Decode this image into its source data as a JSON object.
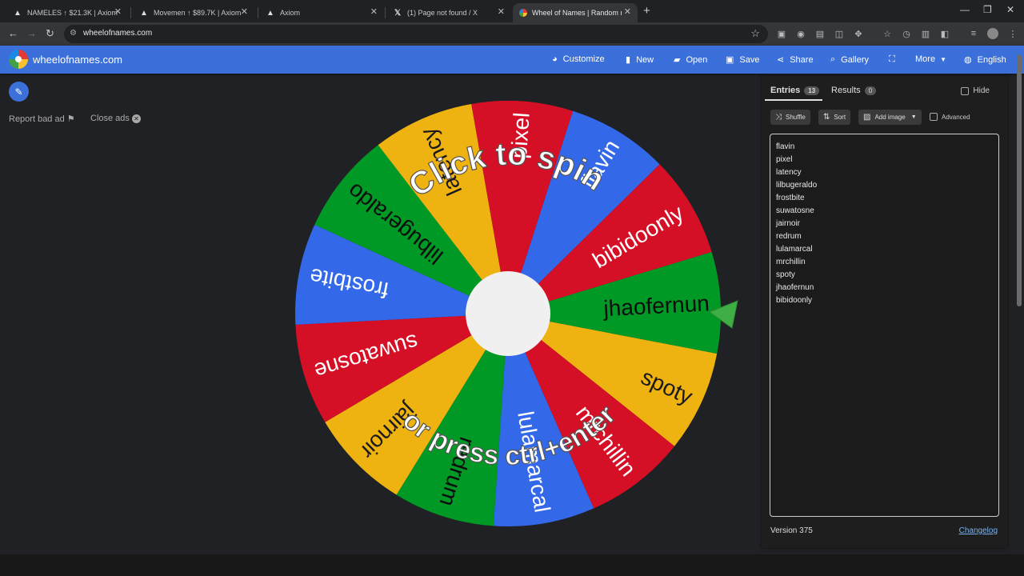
{
  "browser": {
    "tabs": [
      {
        "title": "NAMELES ↑ $21.3K | Axiom",
        "icon": "axiom-icon"
      },
      {
        "title": "Movemen ↑ $89.7K | Axiom",
        "icon": "axiom-icon"
      },
      {
        "title": "Axiom",
        "icon": "axiom-icon"
      },
      {
        "title": "(1) Page not found / X",
        "icon": "x-icon"
      },
      {
        "title": "Wheel of Names | Random nam",
        "icon": "wheel-icon"
      }
    ],
    "active_tab_index": 4,
    "url": "wheelofnames.com"
  },
  "header": {
    "brand": "wheelofnames.com",
    "menu": {
      "customize": "Customize",
      "new": "New",
      "open": "Open",
      "save": "Save",
      "share": "Share",
      "gallery": "Gallery",
      "more": "More",
      "language": "English"
    }
  },
  "ads": {
    "report": "Report bad ad",
    "close": "Close ads"
  },
  "wheel": {
    "prompt_top": "Click to spin",
    "prompt_bottom": "or press ctrl+enter",
    "colors": [
      "#3369e8",
      "#d50f25",
      "#eeb211",
      "#009925"
    ],
    "segments": [
      {
        "label": "jhaofernun",
        "color": "#009925"
      },
      {
        "label": "spoty",
        "color": "#eeb211"
      },
      {
        "label": "mrchillin",
        "color": "#d50f25"
      },
      {
        "label": "lulamarcal",
        "color": "#3369e8"
      },
      {
        "label": "redrum",
        "color": "#009925"
      },
      {
        "label": "jairnoir",
        "color": "#eeb211"
      },
      {
        "label": "suwatosne",
        "color": "#d50f25"
      },
      {
        "label": "frostbite",
        "color": "#3369e8"
      },
      {
        "label": "lilbugeraldo",
        "color": "#009925"
      },
      {
        "label": "latency",
        "color": "#eeb211"
      },
      {
        "label": "pixel",
        "color": "#d50f25"
      },
      {
        "label": "flavin",
        "color": "#3369e8"
      },
      {
        "label": "bibidoonly",
        "color": "#d50f25"
      }
    ]
  },
  "panel": {
    "tabs": {
      "entries": {
        "label": "Entries",
        "count": "13"
      },
      "results": {
        "label": "Results",
        "count": "0"
      }
    },
    "hide": "Hide",
    "buttons": {
      "shuffle": "Shuffle",
      "sort": "Sort",
      "add_image": "Add image",
      "advanced": "Advanced"
    },
    "entries": [
      "flavin",
      "pixel",
      "latency",
      "lilbugeraldo",
      "frostbite",
      "suwatosne",
      "jairnoir",
      "redrum",
      "lulamarcal",
      "mrchillin",
      "spoty",
      "jhaofernun",
      "bibidoonly"
    ],
    "version": "Version 375",
    "changelog": "Changelog"
  }
}
